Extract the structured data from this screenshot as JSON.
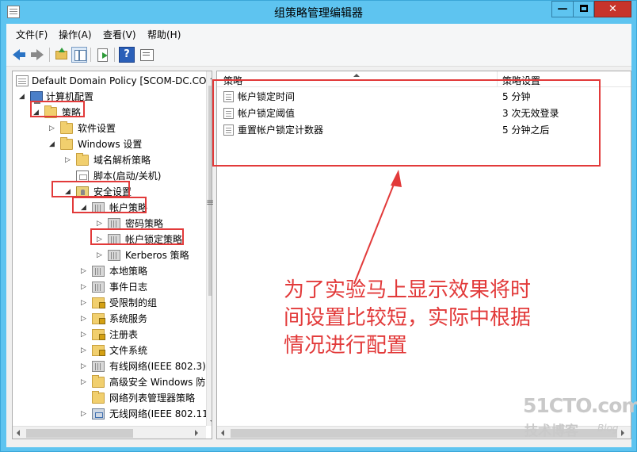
{
  "window": {
    "title": "组策略管理编辑器",
    "caption_min": "—",
    "caption_close": "✕"
  },
  "menu": {
    "items": [
      "文件(F)",
      "操作(A)",
      "查看(V)",
      "帮助(H)"
    ]
  },
  "tree": {
    "items": [
      {
        "label": "Default Domain Policy [SCOM-DC.CO",
        "twisty": ""
      },
      {
        "label": "计算机配置",
        "twisty": "◢"
      },
      {
        "label": "策略",
        "twisty": "◢"
      },
      {
        "label": "软件设置",
        "twisty": "▷"
      },
      {
        "label": "Windows 设置",
        "twisty": "◢"
      },
      {
        "label": "域名解析策略",
        "twisty": "▷"
      },
      {
        "label": "脚本(启动/关机)",
        "twisty": ""
      },
      {
        "label": "安全设置",
        "twisty": "◢"
      },
      {
        "label": "帐户策略",
        "twisty": "◢"
      },
      {
        "label": "密码策略",
        "twisty": "▷"
      },
      {
        "label": "帐户锁定策略",
        "twisty": "▷"
      },
      {
        "label": "Kerberos 策略",
        "twisty": "▷"
      },
      {
        "label": "本地策略",
        "twisty": "▷"
      },
      {
        "label": "事件日志",
        "twisty": "▷"
      },
      {
        "label": "受限制的组",
        "twisty": "▷"
      },
      {
        "label": "系统服务",
        "twisty": "▷"
      },
      {
        "label": "注册表",
        "twisty": "▷"
      },
      {
        "label": "文件系统",
        "twisty": "▷"
      },
      {
        "label": "有线网络(IEEE 802.3)",
        "twisty": "▷"
      },
      {
        "label": "高级安全 Windows 防",
        "twisty": "▷"
      },
      {
        "label": "网络列表管理器策略",
        "twisty": ""
      },
      {
        "label": "无线网络(IEEE 802.11",
        "twisty": "▷"
      }
    ]
  },
  "list": {
    "columns": [
      "策略",
      "策略设置"
    ],
    "rows": [
      {
        "name": "帐户锁定时间",
        "value": "5 分钟"
      },
      {
        "name": "帐户锁定阈值",
        "value": "3 次无效登录"
      },
      {
        "name": "重置帐户锁定计数器",
        "value": "5 分钟之后"
      }
    ]
  },
  "annotation": {
    "lines": [
      "为了实验马上显示效果将时",
      "间设置比较短，实际中根据",
      "情况进行配置"
    ]
  },
  "watermark": {
    "main": "51CTO.com",
    "sub": "技术博客",
    "blog": "Blog"
  },
  "icons": {
    "help": "?"
  },
  "colors": {
    "titlebar": "#5ec4f0",
    "close_button": "#c7342b",
    "annotation_red": "#e23a3a"
  }
}
